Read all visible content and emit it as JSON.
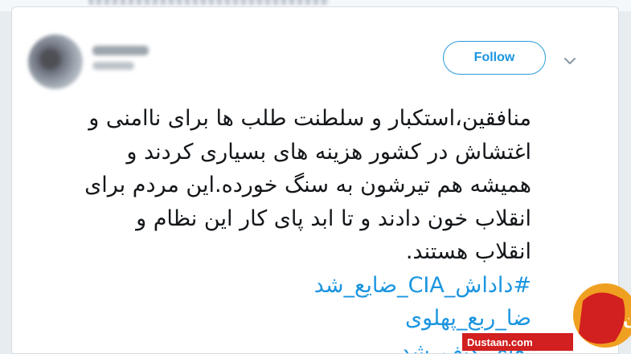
{
  "tweet": {
    "follow_label": "Follow",
    "text_lines": [
      "منافقین،استکبار و سلطنت طلب ها برای ناامنی و",
      "اغتشاش در کشور هزینه های بسیاری کردند و",
      "همیشه هم تیرشون به سنگ خورده.این مردم برای",
      "انقلاب خون دادند و تا ابد پای کار این نظام و",
      "انقلاب هستند."
    ],
    "hashtags": [
      "#داداش_CIA_ضایع_شد",
      "ضا_ربع_پهلوی",
      "ـعای_کنف_شد"
    ]
  },
  "watermark": {
    "logo_text": "مجله دوستان",
    "site": "Dustaan.com"
  },
  "colors": {
    "link": "#1b95e0",
    "text": "#14171a",
    "watermark_red": "#d21f1f",
    "watermark_orange": "#f0a020",
    "background": "#e6ecf0"
  },
  "icons": {
    "menu": "chevron-down-icon"
  }
}
